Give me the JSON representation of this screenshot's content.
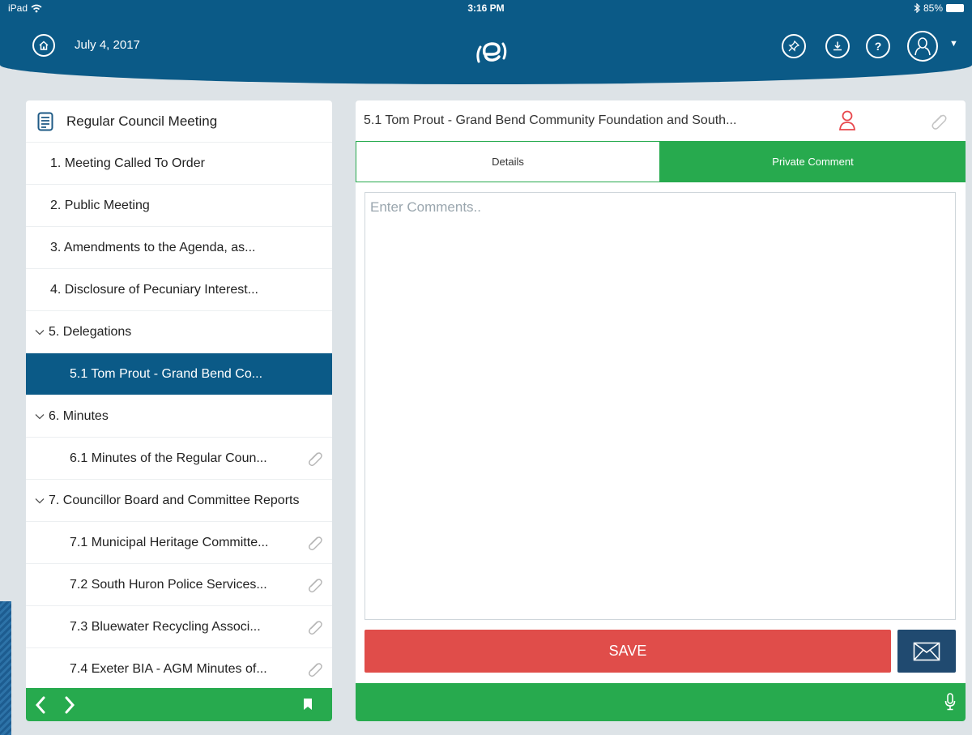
{
  "status_bar": {
    "device": "iPad",
    "time": "3:16 PM",
    "battery": "85%"
  },
  "header": {
    "date": "July 4, 2017",
    "help_label": "?",
    "icons": [
      "home-icon",
      "pin-icon",
      "download-icon",
      "help-icon",
      "profile-icon",
      "logo"
    ]
  },
  "left_panel": {
    "title": "Regular Council Meeting",
    "items": [
      {
        "label": "1. Meeting Called To Order"
      },
      {
        "label": "2. Public Meeting"
      },
      {
        "label": "3. Amendments to the Agenda, as..."
      },
      {
        "label": "4. Disclosure of Pecuniary Interest..."
      },
      {
        "label": "5. Delegations"
      },
      {
        "label": "5.1 Tom Prout - Grand Bend Co..."
      },
      {
        "label": "6. Minutes"
      },
      {
        "label": "6.1 Minutes of the Regular Coun..."
      },
      {
        "label": "7. Councillor Board and Committee Reports"
      },
      {
        "label": "7.1 Municipal Heritage Committe..."
      },
      {
        "label": "7.2 South Huron Police Services..."
      },
      {
        "label": "7.3 Bluewater Recycling Associ..."
      },
      {
        "label": "7.4 Exeter BIA - AGM Minutes of..."
      }
    ]
  },
  "right_panel": {
    "title": "5.1 Tom Prout - Grand Bend Community Foundation and South...",
    "tabs": {
      "details": "Details",
      "private_comment": "Private Comment"
    },
    "comment_placeholder": "Enter Comments..",
    "save_label": "SAVE"
  },
  "colors": {
    "header_blue": "#0b5a87",
    "green": "#27aa4e",
    "save_red": "#e04d4a",
    "email_navy": "#204a70",
    "presenter_red": "#e8474c"
  }
}
